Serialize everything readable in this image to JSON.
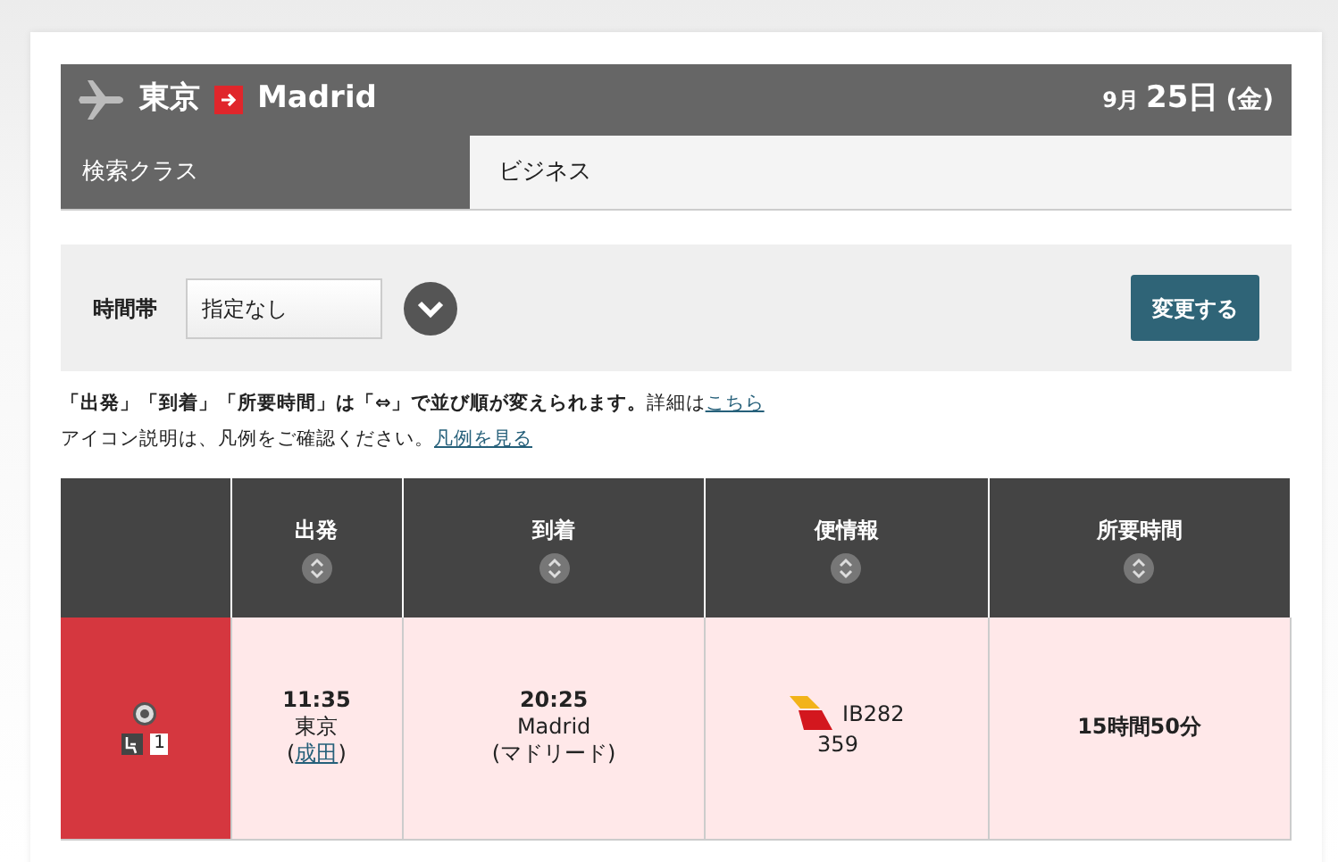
{
  "header": {
    "origin": "東京",
    "destination": "Madrid",
    "month": "9月",
    "day": "25日",
    "weekday": "(金)"
  },
  "search_class": {
    "label": "検索クラス",
    "value": "ビジネス"
  },
  "filter": {
    "label": "時間帯",
    "select_value": "指定なし",
    "button": "変更する"
  },
  "notes": [
    {
      "text": "**「出発」「到着」「所要時間」は「⇔」で並び順が変えられます。**詳細は",
      "link": "こちら"
    },
    {
      "text": "アイコン説明は、凡例をご確認ください。",
      "link": "凡例を見る"
    }
  ],
  "table": {
    "columns": [
      "出発",
      "到着",
      "便情報",
      "所要時間"
    ],
    "rows": [
      {
        "selected": true,
        "seats": "1",
        "dep_time": "11:35",
        "dep_city": "東京",
        "dep_open": "(",
        "dep_airport": "成田",
        "dep_close": ")",
        "arr_time": "20:25",
        "arr_city": "Madrid",
        "arr_airport": "(マドリード)",
        "flight_number": "IB282",
        "aircraft": "359",
        "duration": "15時間50分"
      }
    ]
  }
}
